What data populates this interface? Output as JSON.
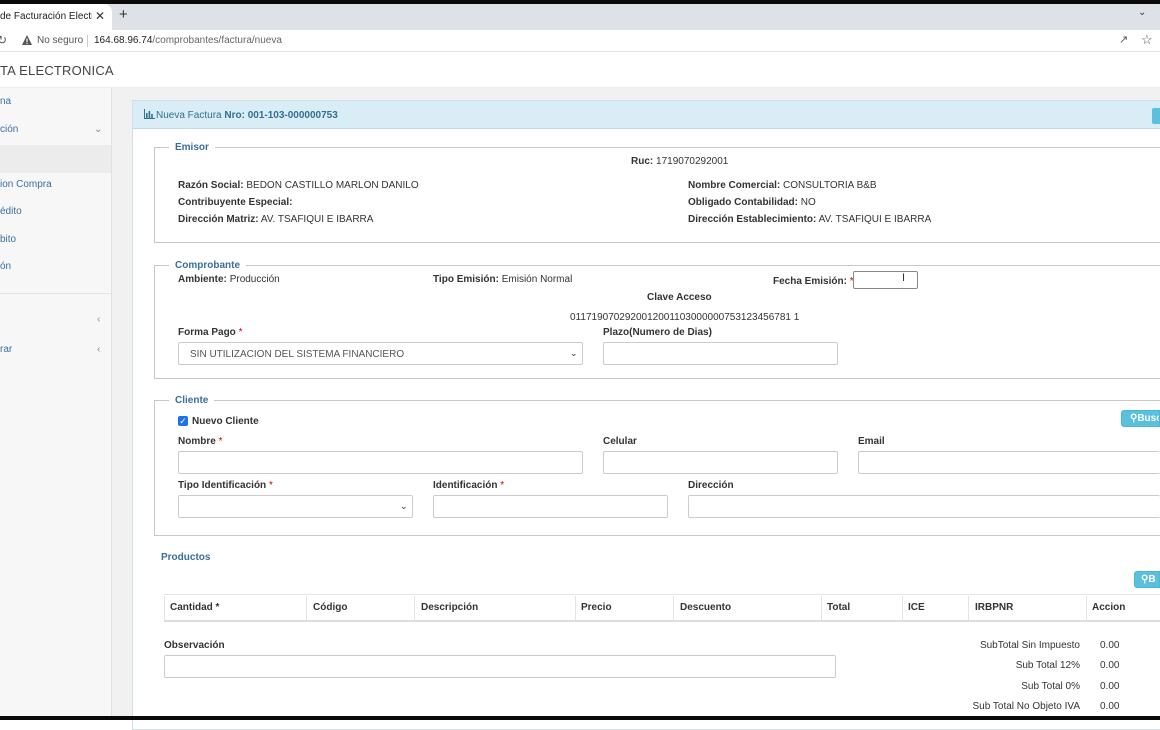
{
  "browser": {
    "tab_title": "de Facturación Electrónica",
    "tab_close": "✕",
    "new_tab": "+",
    "insecure_label": "No seguro",
    "url_host": "164.68.96.74",
    "url_path": "/comprobantes/factura/nueva"
  },
  "app": {
    "title": "TA ELECTRONICA"
  },
  "sidebar": {
    "items": [
      {
        "label": "na"
      },
      {
        "label": "ción"
      },
      {
        "label": ""
      },
      {
        "label": "ion Compra"
      },
      {
        "label": "édito"
      },
      {
        "label": "bito"
      },
      {
        "label": "ón"
      },
      {
        "label": ""
      },
      {
        "label": "rar"
      }
    ]
  },
  "panel": {
    "title_prefix": "Nueva Factura",
    "title_number": "Nro: 001-103-000000753"
  },
  "emisor": {
    "legend": "Emisor",
    "ruc_label": "Ruc:",
    "ruc_value": "1719070292001",
    "razon_label": "Razón Social:",
    "razon_value": "BEDON CASTILLO MARLON DANILO",
    "contribuyente_label": "Contribuyente Especial:",
    "contribuyente_value": "",
    "direccion_label": "Dirección Matriz:",
    "direccion_value": "AV. TSAFIQUI E IBARRA",
    "nombre_comercial_label": "Nombre Comercial:",
    "nombre_comercial_value": "CONSULTORIA B&B",
    "obligado_label": "Obligado Contabilidad:",
    "obligado_value": "NO",
    "dir_estab_label": "Dirección Establecimiento:",
    "dir_estab_value": "AV. TSAFIQUI E IBARRA"
  },
  "comprobante": {
    "legend": "Comprobante",
    "ambiente_label": "Ambiente:",
    "ambiente_value": "Producción",
    "tipo_emision_label": "Tipo Emisión:",
    "tipo_emision_value": "Emisión Normal",
    "fecha_label": "Fecha Emisión:",
    "required_mark": "*",
    "clave_label": "Clave Acceso",
    "clave_value": "0117190702920012001103000000753123456781 1",
    "forma_pago_label": "Forma Pago",
    "forma_pago_value": "SIN UTILIZACION DEL SISTEMA FINANCIERO",
    "plazo_label": "Plazo(Numero de Dias)"
  },
  "cliente": {
    "legend": "Cliente",
    "nuevo_cliente_label": "Nuevo Cliente",
    "nuevo_cliente_checked": true,
    "buscar_label": "Busca",
    "nombre_label": "Nombre",
    "celular_label": "Celular",
    "email_label": "Email",
    "tipo_id_label": "Tipo Identificación",
    "identificacion_label": "Identificación",
    "direccion_label": "Dirección"
  },
  "productos": {
    "title": "Productos",
    "buscar_label": "B",
    "columns": [
      "Cantidad *",
      "Código",
      "Descripción",
      "Precio",
      "Descuento",
      "Total",
      "ICE",
      "IRBPNR",
      "Accion"
    ]
  },
  "observacion": {
    "label": "Observación"
  },
  "totales": [
    {
      "label": "SubTotal Sin Impuesto",
      "value": "0.00"
    },
    {
      "label": "Sub Total 12%",
      "value": "0.00"
    },
    {
      "label": "Sub Total 0%",
      "value": "0.00"
    },
    {
      "label": "Sub Total No Objeto IVA",
      "value": "0.00"
    }
  ],
  "colors": {
    "accent": "#3a6e9e",
    "panel_header": "#d9edf7",
    "info_button": "#5bc0de"
  }
}
